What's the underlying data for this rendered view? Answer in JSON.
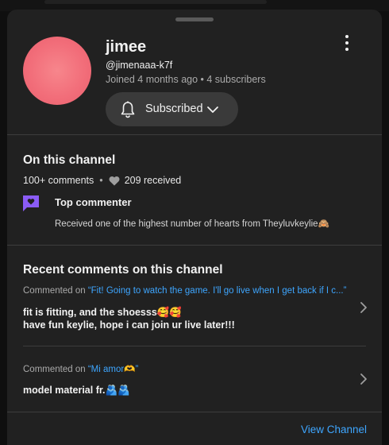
{
  "channel": {
    "name": "jimee",
    "handle": "@jimenaaa-k7f",
    "joined_info": "Joined 4 months ago • 4 subscribers",
    "subscribe_label": "Subscribed"
  },
  "on_channel": {
    "title": "On this channel",
    "comments_count": "100+ comments",
    "separator": "•",
    "hearts_received": "209 received",
    "badge_title": "Top commenter",
    "badge_desc": "Received one of the highest number of hearts from Theyluvkeylie🙈"
  },
  "recent": {
    "title": "Recent comments on this channel",
    "comments": [
      {
        "prefix": "Commented on ",
        "video_title": "“Fit! Going to watch the game. I'll go live when I get back if I c...”",
        "lines": [
          "fit is fitting, and the shoesss🥰🥰",
          "have fun keylie, hope i can join ur live later!!!"
        ]
      },
      {
        "prefix": "Commented on ",
        "video_title": "“Mi amor🫶”",
        "lines": [
          "model material fr.🫂🫂"
        ]
      }
    ]
  },
  "footer": {
    "view_channel": "View Channel"
  },
  "colors": {
    "accent_link": "#3ea6ff",
    "badge": "#8b5cf6",
    "avatar": "#f26e7a"
  },
  "icons": [
    "kebab-menu-icon",
    "bell-icon",
    "chevron-down-icon",
    "heart-icon",
    "top-commenter-badge-icon",
    "chevron-right-icon"
  ]
}
